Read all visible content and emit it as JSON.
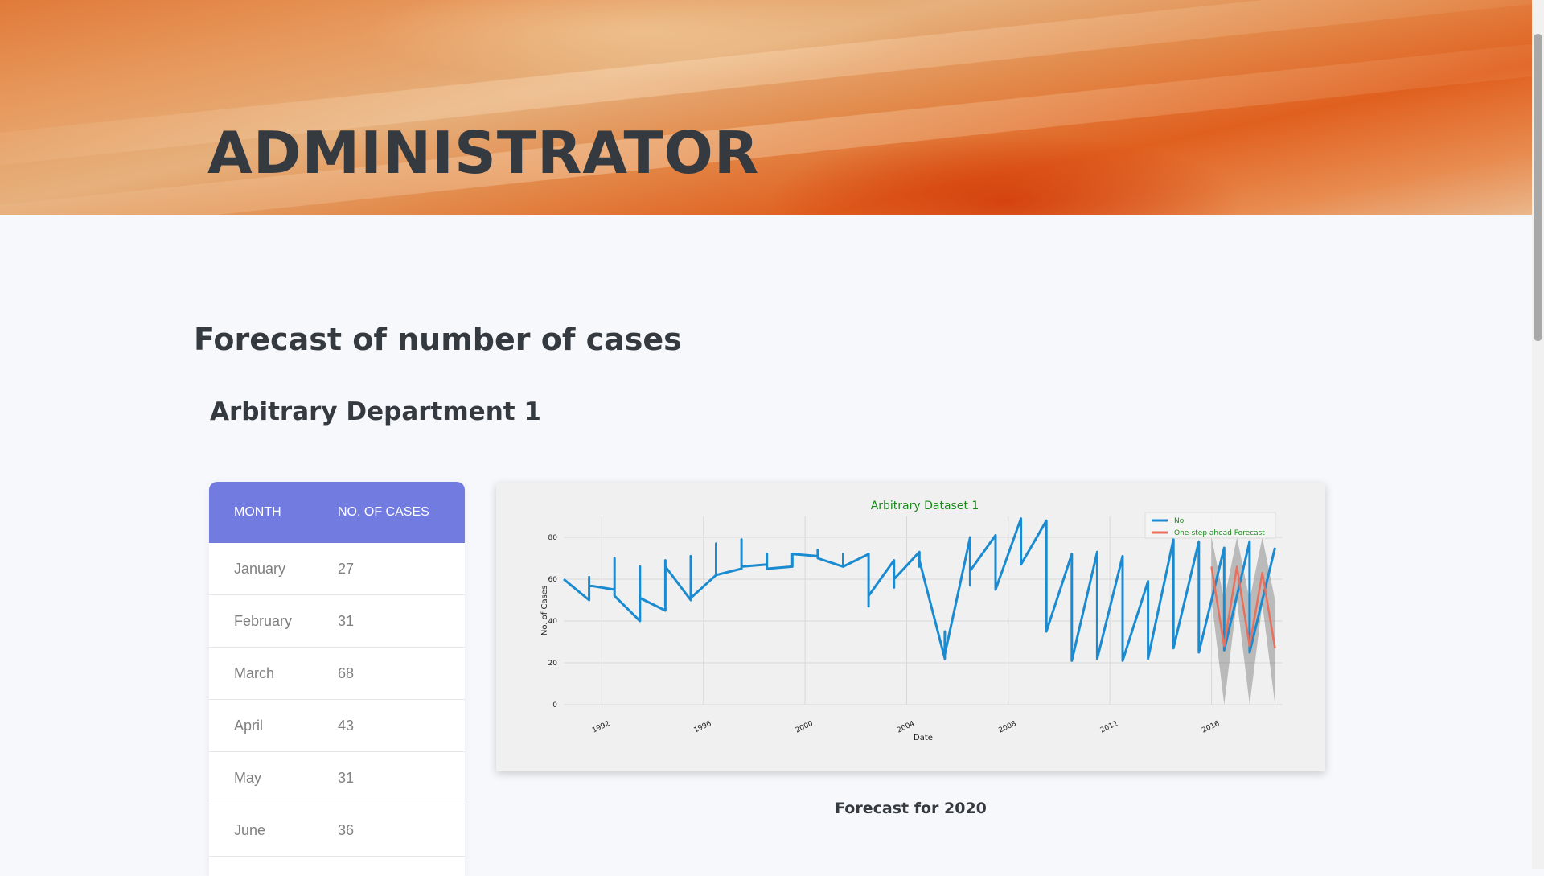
{
  "header": {
    "title": "ADMINISTRATOR"
  },
  "section": {
    "title": "Forecast of number of cases"
  },
  "department": {
    "title": "Arbitrary Department 1"
  },
  "table": {
    "headers": [
      "MONTH",
      "NO. OF CASES"
    ],
    "rows": [
      {
        "month": "January",
        "cases": "27"
      },
      {
        "month": "February",
        "cases": "31"
      },
      {
        "month": "March",
        "cases": "68"
      },
      {
        "month": "April",
        "cases": "43"
      },
      {
        "month": "May",
        "cases": "31"
      },
      {
        "month": "June",
        "cases": "36"
      }
    ]
  },
  "chart_caption": "Forecast for 2020",
  "colors": {
    "table_header": "#727ce0",
    "observed_line": "#1a8bd0",
    "forecast_line": "#e8705c",
    "title_green": "#1a8a1a"
  },
  "chart_data": {
    "type": "line",
    "title": "Arbitrary Dataset 1",
    "xlabel": "Date",
    "ylabel": "No. of Cases",
    "xlim": [
      1990.5,
      2018.8
    ],
    "ylim": [
      0,
      90
    ],
    "yticks": [
      0,
      20,
      40,
      60,
      80
    ],
    "xticks": [
      "1992",
      "1996",
      "2000",
      "2004",
      "2008",
      "2012",
      "2016"
    ],
    "grid": true,
    "legend_position": "top-right",
    "series": [
      {
        "name": "No",
        "color": "#1a8bd0",
        "x": [
          1990.5,
          1991.5,
          1991.5,
          1991.5,
          1992.5,
          1992.5,
          1992.5,
          1993.5,
          1993.5,
          1993.5,
          1994.5,
          1994.5,
          1994.5,
          1995.5,
          1995.5,
          1995.5,
          1996.5,
          1996.5,
          1996.5,
          1997.5,
          1997.5,
          1997.5,
          1998.5,
          1998.5,
          1998.5,
          1999.5,
          1999.5,
          1999.5,
          2000.5,
          2000.5,
          2000.5,
          2001.5,
          2001.5,
          2001.5,
          2002.5,
          2002.5,
          2002.5,
          2003.5,
          2003.5,
          2003.5,
          2004.5,
          2004.5,
          2004.5,
          2005.5,
          2005.5,
          2005.5,
          2006.5,
          2006.5,
          2006.5,
          2007.5,
          2007.5,
          2007.5,
          2008.5,
          2008.5,
          2008.5,
          2009.5,
          2009.5,
          2009.5,
          2010.5,
          2010.5,
          2010.5,
          2011.5,
          2011.5,
          2011.5,
          2012.5,
          2012.5,
          2012.5,
          2013.5,
          2013.5,
          2013.5,
          2014.5,
          2014.5,
          2014.5,
          2015.5,
          2015.5,
          2015.5,
          2016.5,
          2016.5,
          2016.5,
          2017.5,
          2017.5,
          2017.5,
          2018.5
        ],
        "y": [
          60,
          50,
          61,
          57,
          55,
          70,
          52,
          40,
          66,
          51,
          45,
          69,
          66,
          50,
          71,
          51,
          62,
          77,
          62,
          65,
          79,
          66,
          67,
          72,
          65,
          66,
          70,
          72,
          71,
          74,
          70,
          66,
          72,
          66,
          72,
          47,
          52,
          69,
          56,
          60,
          73,
          66,
          69,
          22,
          35,
          24,
          80,
          57,
          64,
          81,
          65,
          55,
          89,
          80,
          67,
          88,
          55,
          35,
          72,
          56,
          21,
          73,
          60,
          22,
          71,
          58,
          21,
          59,
          50,
          22,
          79,
          55,
          27,
          78,
          60,
          25,
          75,
          67,
          26,
          78,
          64,
          25,
          75
        ]
      },
      {
        "name": "One-step ahead Forecast",
        "color": "#e8705c",
        "x": [
          2016.0,
          2016.5,
          2017.0,
          2017.5,
          2018.0,
          2018.5
        ],
        "y": [
          66,
          28,
          66,
          28,
          63,
          27
        ],
        "ci_lower": [
          50,
          0,
          50,
          0,
          48,
          0
        ],
        "ci_upper": [
          80,
          50,
          80,
          50,
          80,
          50
        ]
      }
    ]
  }
}
